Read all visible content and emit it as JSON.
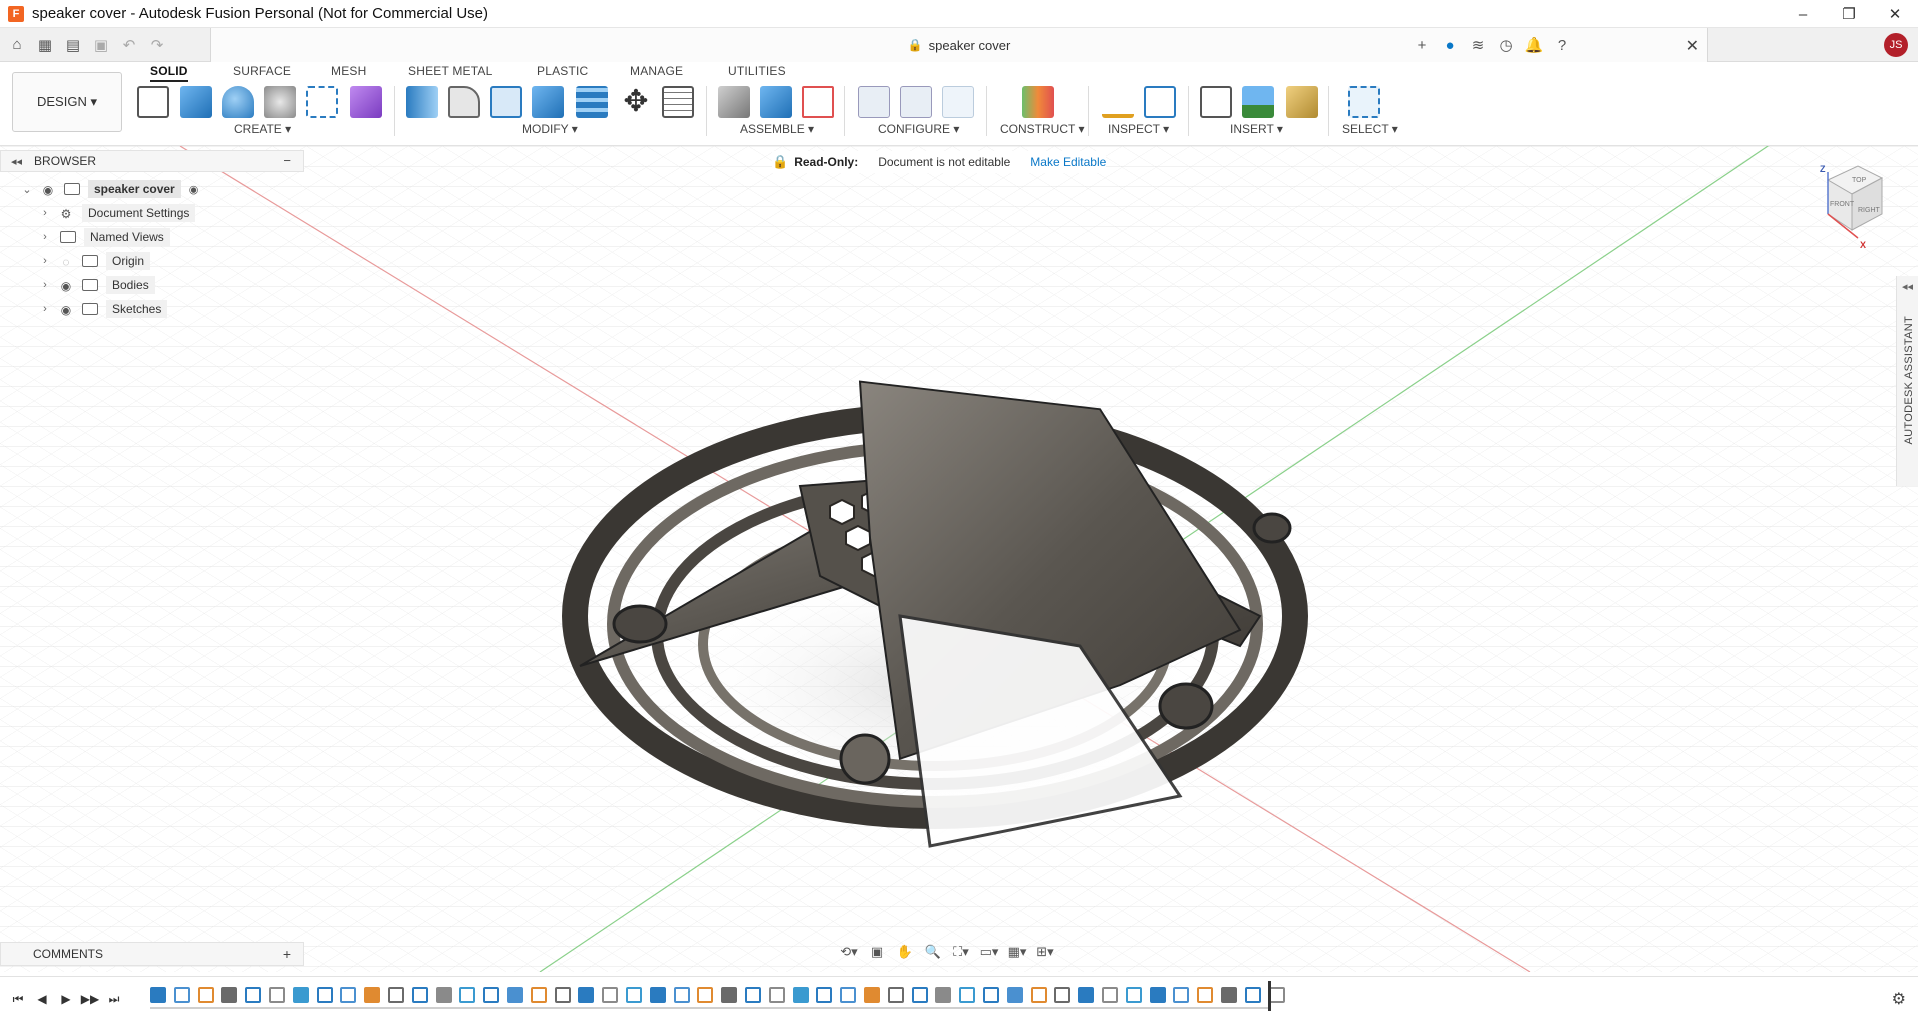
{
  "window": {
    "logo_letter": "F",
    "title": "speaker cover - Autodesk Fusion Personal (Not for Commercial Use)",
    "controls": [
      "–",
      "❐",
      "✕"
    ]
  },
  "quick_access": {
    "icons": [
      "home-icon",
      "grid-icon",
      "file-icon",
      "save-icon",
      "undo-icon",
      "redo-icon"
    ]
  },
  "document_tab": {
    "name": "speaker cover",
    "close": "✕"
  },
  "right_tools": {
    "icons": [
      "add-tab-icon",
      "online-icon",
      "job-status-icon",
      "clock-icon",
      "notifications-icon",
      "help-icon"
    ],
    "avatar_initials": "JS"
  },
  "toolbar": {
    "workspace": "DESIGN ▾",
    "tabs": [
      "SOLID",
      "SURFACE",
      "MESH",
      "SHEET METAL",
      "PLASTIC",
      "MANAGE",
      "UTILITIES"
    ],
    "active_tab": "SOLID",
    "groups": [
      "CREATE ▾",
      "MODIFY ▾",
      "ASSEMBLE ▾",
      "CONFIGURE ▾",
      "CONSTRUCT ▾",
      "INSPECT ▾",
      "INSERT ▾",
      "SELECT ▾"
    ]
  },
  "browser": {
    "title": "BROWSER",
    "collapse": "◂◂",
    "minimize": "−",
    "items": [
      {
        "label": "speaker cover",
        "chevron": "⌄",
        "eye": "◉"
      },
      {
        "label": "Document Settings",
        "chevron": "›",
        "eye": "⚙"
      },
      {
        "label": "Named Views",
        "chevron": "›",
        "eye": ""
      },
      {
        "label": "Origin",
        "chevron": "›",
        "eye": "◌"
      },
      {
        "label": "Bodies",
        "chevron": "›",
        "eye": "◉"
      },
      {
        "label": "Sketches",
        "chevron": "›",
        "eye": "◉"
      }
    ]
  },
  "readonly": {
    "label": "Read-Only:",
    "message": "Document is not editable",
    "action": "Make Editable"
  },
  "viewcube": {
    "top": "TOP",
    "front": "FRONT",
    "right": "RIGHT",
    "z_axis": "Z",
    "x_axis": "X"
  },
  "side_panel": {
    "label": "AUTODESK ASSISTANT",
    "collapse": "◂◂"
  },
  "comments": {
    "title": "COMMENTS",
    "add": "+"
  },
  "navbar": {
    "icons": [
      "orbit-icon",
      "look-at-icon",
      "pan-icon",
      "zoom-icon",
      "fit-icon",
      "display-settings-icon",
      "grid-settings-icon",
      "viewports-icon"
    ]
  },
  "timeline": {
    "controls": [
      "⏮",
      "◀",
      "▶",
      "▶▶",
      "⏭"
    ],
    "settings": "⚙"
  },
  "colors": {
    "accent": "#0a78c8",
    "avatar": "#b3202a",
    "logo": "#f26522",
    "readonly_lock": "#e8a000",
    "axis_x": "#e06060",
    "axis_y": "#60c060"
  }
}
